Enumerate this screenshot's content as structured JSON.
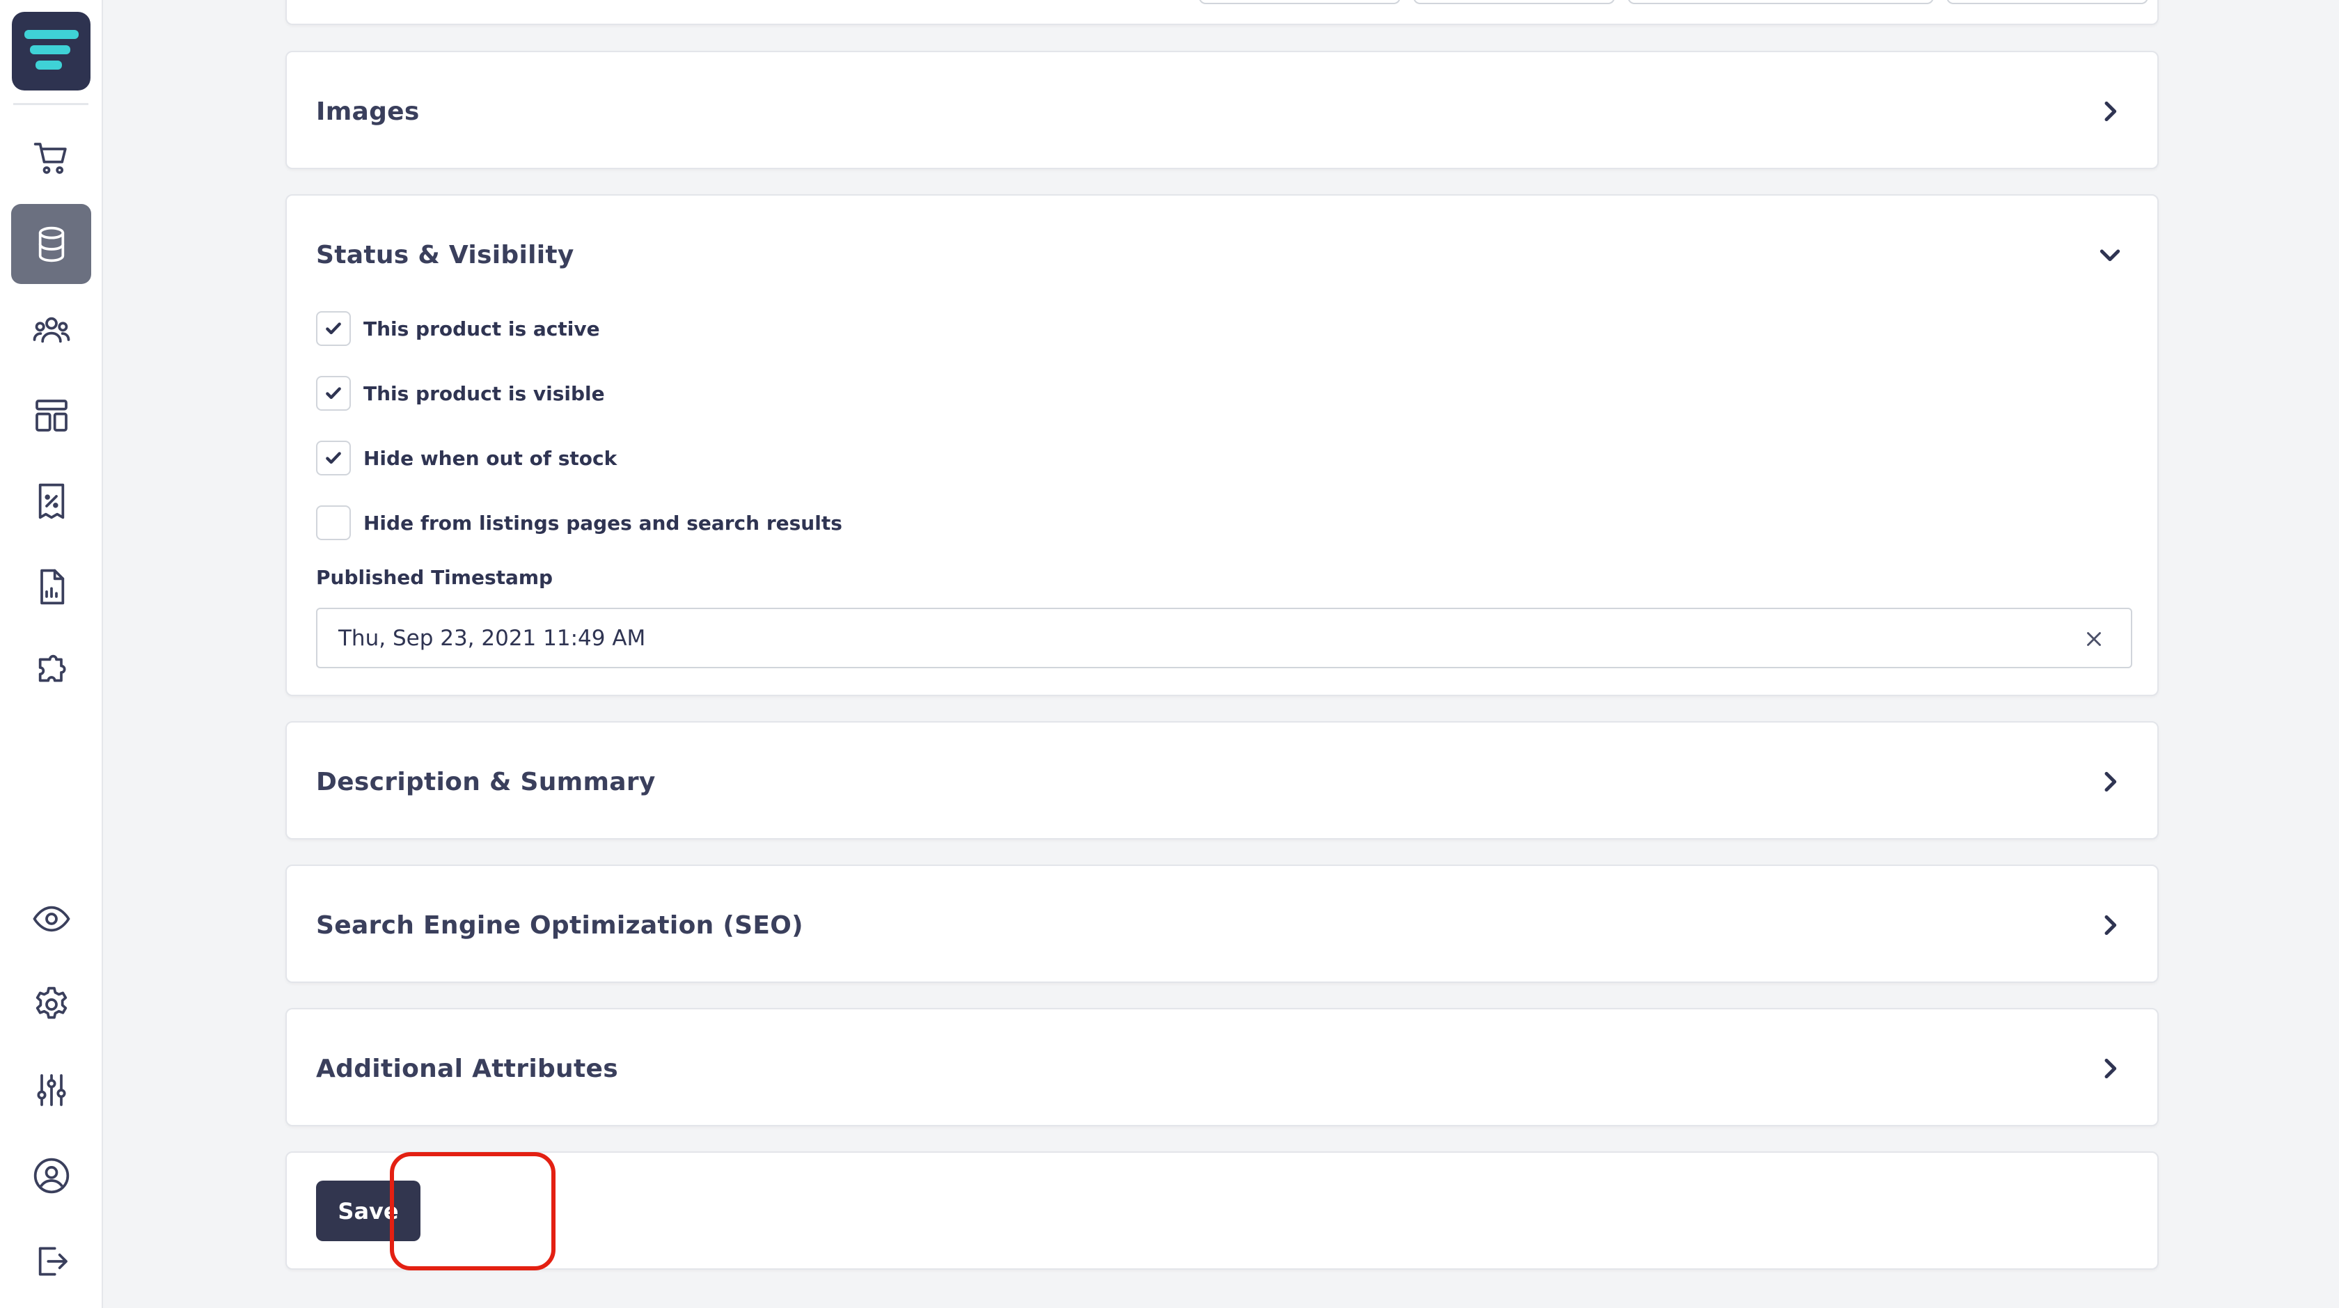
{
  "sidebar": {
    "logo": "logo-icon",
    "items": [
      {
        "name": "orders",
        "icon": "shopping-cart-icon",
        "active": false
      },
      {
        "name": "catalog",
        "icon": "database-icon",
        "active": true
      },
      {
        "name": "customers",
        "icon": "users-icon",
        "active": false
      },
      {
        "name": "content",
        "icon": "layout-icon",
        "active": false
      },
      {
        "name": "discounts",
        "icon": "receipt-percent-icon",
        "active": false
      },
      {
        "name": "reports",
        "icon": "report-chart-icon",
        "active": false
      },
      {
        "name": "extensions",
        "icon": "puzzle-icon",
        "active": false
      }
    ],
    "bottom_items": [
      {
        "name": "view-store",
        "icon": "eye-icon"
      },
      {
        "name": "settings",
        "icon": "gear-icon"
      },
      {
        "name": "preferences",
        "icon": "sliders-icon"
      },
      {
        "name": "account",
        "icon": "user-circle-icon"
      },
      {
        "name": "logout",
        "icon": "logout-icon"
      }
    ]
  },
  "sections": {
    "images": {
      "title": "Images",
      "expanded": false
    },
    "status": {
      "title": "Status & Visibility",
      "expanded": true,
      "checkboxes": [
        {
          "label": "This product is active",
          "checked": true
        },
        {
          "label": "This product is visible",
          "checked": true
        },
        {
          "label": "Hide when out of stock",
          "checked": true
        },
        {
          "label": "Hide from listings pages and search results",
          "checked": false
        }
      ],
      "published_label": "Published Timestamp",
      "published_value": "Thu, Sep 23, 2021 11:49 AM"
    },
    "description": {
      "title": "Description & Summary",
      "expanded": false
    },
    "seo": {
      "title": "Search Engine Optimization (SEO)",
      "expanded": false
    },
    "attributes": {
      "title": "Additional Attributes",
      "expanded": false
    }
  },
  "actions": {
    "save_label": "Save"
  },
  "colors": {
    "primary": "#32364f",
    "highlight": "#e32012",
    "checkmark": "#2f3452"
  }
}
